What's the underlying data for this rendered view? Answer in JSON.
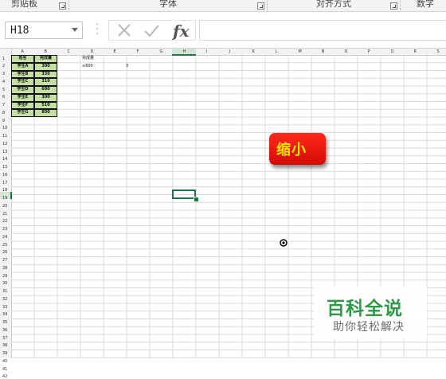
{
  "ribbon": {
    "groups": [
      {
        "label": "剪贴板"
      },
      {
        "label": "字体"
      },
      {
        "label": "对齐方式"
      },
      {
        "label": "数字"
      }
    ]
  },
  "formula_bar": {
    "name_box": "H18",
    "fx_label": "fx",
    "formula_value": ""
  },
  "sheet": {
    "columns": [
      "A",
      "B",
      "C",
      "D",
      "E",
      "F",
      "G",
      "H",
      "I",
      "J",
      "K",
      "L",
      "M",
      "N",
      "O",
      "P",
      "Q",
      "R",
      "S"
    ],
    "rows": [
      "1",
      "2",
      "3",
      "4",
      "5",
      "6",
      "7",
      "8",
      "9",
      "10",
      "11",
      "12",
      "13",
      "14",
      "15",
      "16",
      "17",
      "18",
      "19",
      "20",
      "21",
      "22",
      "23",
      "24",
      "25",
      "26",
      "27",
      "28",
      "29",
      "30",
      "31",
      "32",
      "33",
      "34",
      "35",
      "36",
      "37",
      "38",
      "39",
      "40",
      "41",
      "42"
    ],
    "selected_cell": "H18",
    "table": {
      "headers": [
        "姓名",
        "完成量"
      ],
      "rows": [
        [
          "学生A",
          "300"
        ],
        [
          "学生B",
          "330"
        ],
        [
          "学生C",
          "310"
        ],
        [
          "学生D",
          "680"
        ],
        [
          "学生E",
          "300"
        ],
        [
          "学生F",
          "510"
        ],
        [
          "学生G",
          "800"
        ]
      ]
    },
    "side_label": "完成量",
    "side_row": [
      "≥600",
      "3"
    ]
  },
  "annotation": {
    "text": "缩小",
    "color": "#ffe600",
    "background": "#e0140b"
  },
  "watermark": {
    "title": "百科全说",
    "subtitle": "助你轻松解决",
    "color": "#2e9a47"
  },
  "colors": {
    "accent": "#217346",
    "table_fill": "#c4dfa4"
  }
}
